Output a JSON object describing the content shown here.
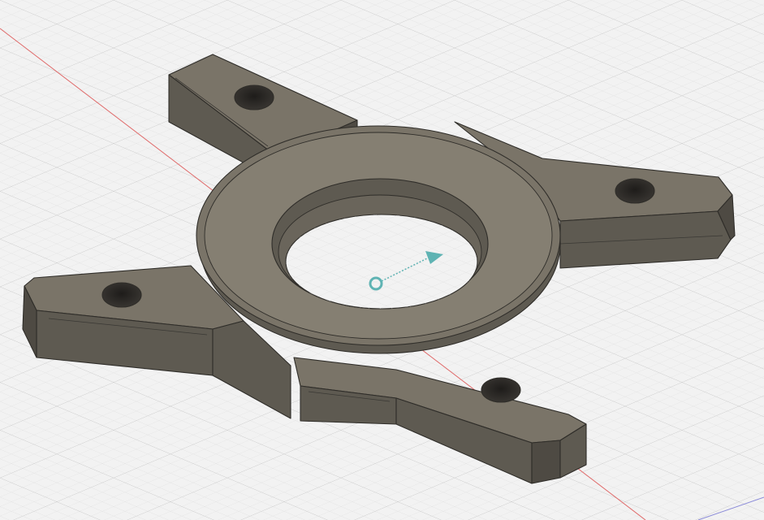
{
  "app": {
    "view": "3d-model-viewport"
  },
  "colors": {
    "background": "#f2f2f2",
    "grid_minor": "#dcdcdc",
    "grid_major": "#c8c8c8",
    "x_axis": "#e06a6a",
    "y_axis": "#8a8ad8",
    "model_top": "#7a7468",
    "model_top_light": "#857f72",
    "model_side": "#5e5a51",
    "model_side_dark": "#4e4a43",
    "model_edge": "#2f2d29",
    "hole": "#2a2826",
    "origin_marker": "#5fb3b3"
  },
  "icons": {
    "origin": "origin-icon",
    "axis_arrow": "axis-arrow-icon"
  }
}
